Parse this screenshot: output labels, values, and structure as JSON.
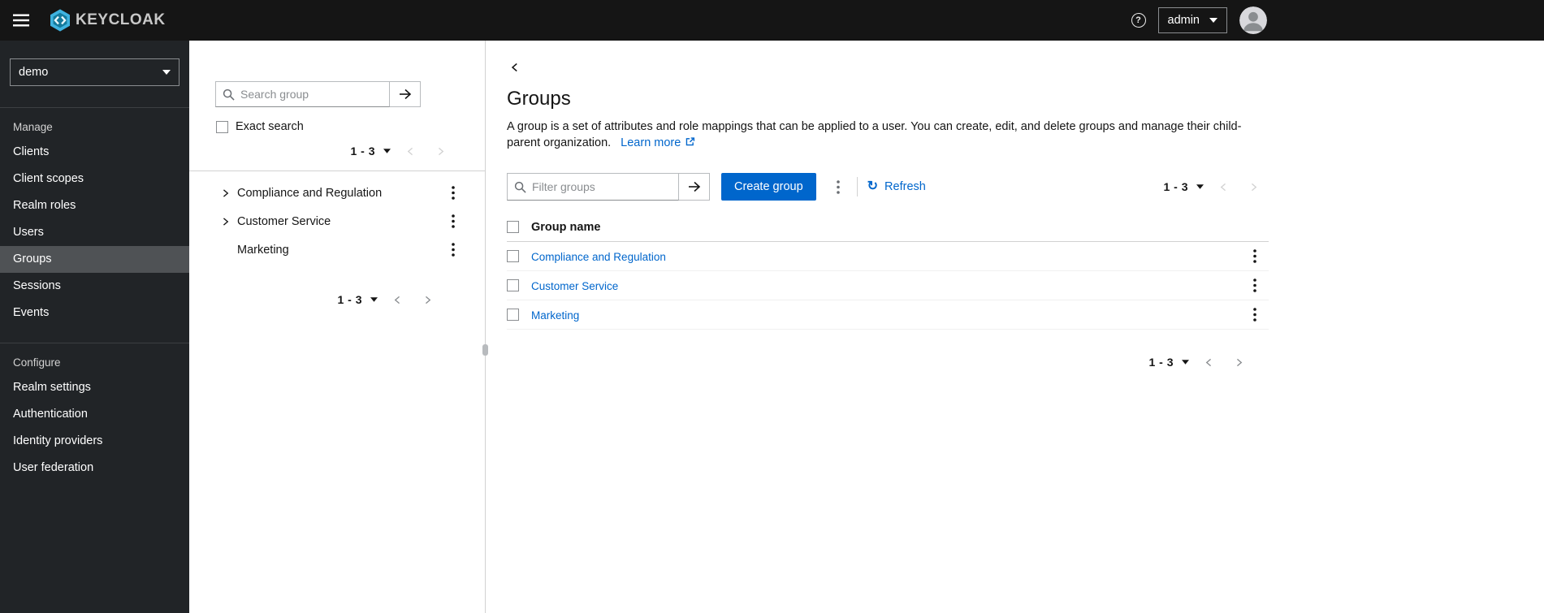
{
  "colors": {
    "primary": "#0066cc",
    "link": "#0066cc",
    "topbar_bg": "#151515",
    "sidebar_bg": "#212427",
    "sidebar_selected_bg": "#4f5255"
  },
  "icons": {
    "help_glyph": "?",
    "refresh_glyph": "↻"
  },
  "topbar": {
    "brand_text": "KEYCLOAK",
    "user_menu": {
      "label": "admin"
    }
  },
  "sidebar": {
    "realm_selector": {
      "value": "demo"
    },
    "sections": [
      {
        "label": "Manage",
        "items": [
          {
            "label": "Clients",
            "selected": false
          },
          {
            "label": "Client scopes",
            "selected": false
          },
          {
            "label": "Realm roles",
            "selected": false
          },
          {
            "label": "Users",
            "selected": false
          },
          {
            "label": "Groups",
            "selected": true
          },
          {
            "label": "Sessions",
            "selected": false
          },
          {
            "label": "Events",
            "selected": false
          }
        ]
      },
      {
        "label": "Configure",
        "items": [
          {
            "label": "Realm settings",
            "selected": false
          },
          {
            "label": "Authentication",
            "selected": false
          },
          {
            "label": "Identity providers",
            "selected": false
          },
          {
            "label": "User federation",
            "selected": false
          }
        ]
      }
    ]
  },
  "tree_panel": {
    "search_placeholder": "Search group",
    "exact_search_label": "Exact search",
    "pagination_label": "1 - 3",
    "bottom_pagination_label": "1 - 3",
    "items": [
      {
        "label": "Compliance and Regulation",
        "expandable": true
      },
      {
        "label": "Customer Service",
        "expandable": true
      },
      {
        "label": "Marketing",
        "expandable": false
      }
    ]
  },
  "main": {
    "title": "Groups",
    "description": "A group is a set of attributes and role mappings that can be applied to a user. You can create, edit, and delete groups and manage their child-parent organization.",
    "learn_more_label": "Learn more",
    "toolbar": {
      "filter_placeholder": "Filter groups",
      "create_button_label": "Create group",
      "refresh_label": "Refresh",
      "pagination_label": "1 - 3"
    },
    "table": {
      "name_column_header": "Group name",
      "rows": [
        {
          "name": "Compliance and Regulation"
        },
        {
          "name": "Customer Service"
        },
        {
          "name": "Marketing"
        }
      ]
    },
    "bottom_pagination_label": "1 - 3"
  }
}
